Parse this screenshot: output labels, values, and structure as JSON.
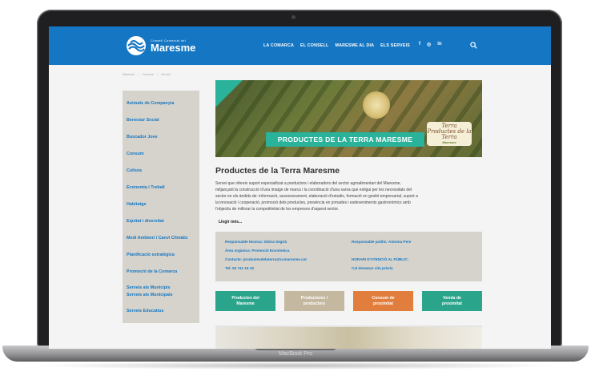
{
  "device": {
    "label": "MacBook Pro"
  },
  "header": {
    "logo_sub": "Consell Comarcal del",
    "logo_name": "Maresme",
    "nav": [
      "LA COMARCA",
      "EL CONSELL",
      "MARESME AL DIA",
      "ELS SERVEIS"
    ],
    "social": [
      "f",
      "◎",
      "in"
    ]
  },
  "breadcrumb": [
    "Maresme",
    "Comarca",
    "Serveis"
  ],
  "sidebar": {
    "items": [
      "Animals de Companyia",
      "Benestar Social",
      "Buscador Jove",
      "Consum",
      "Cultura",
      "Economia i Treball",
      "Habitatge",
      "Equitat i diversitat",
      "Medi Ambient i Canvi Climàtic",
      "Planificació estratègica",
      "Promoció de la Comarca",
      "Serveis als Municipis",
      "Serveis als Municipals",
      "Serveis Educatius"
    ]
  },
  "hero": {
    "banner_text": "PRODUCTES DE LA TERRA MARESME",
    "badge_title": "Terra Productes de la Terra",
    "badge_sub": "Maresme"
  },
  "article": {
    "title": "Productes de la Terra Maresme",
    "lines": [
      "Servei que ofereix suport especialitzat a productors i elaboradors del sector agroalimentari del Maresme,",
      "mitjançant la construcció d'una imatge de marca i la coordinació d'una xarxa que estigui per les necessitats del",
      "sector en els àmbits de: informació, assessorament, elaboració d'estudis, formació en gestió empresarial, suport a",
      "la innovació i cooperació, promoció dels productes, presència en  jornades i esdeveniments gastronòmics amb",
      "l'objectiu de millorar la competitivitat de les empreses d'aquest sector."
    ],
    "read_more": "Llegir més..."
  },
  "contact": {
    "left": [
      "Responsable tècnica: Glòria Segrià",
      "Àrea orgànica: Promoció Econòmica",
      "Contacte: productesdelaterra@ccmaresme.cat",
      "Tel: 93 741 16 33"
    ],
    "right": [
      "Responsable polític: Antonia Pere",
      "",
      "HORARI D'ATENCIÓ AL PÚBLIC:",
      "Cal demanar cita prèvia"
    ]
  },
  "buttons": [
    {
      "line1": "Productes del",
      "line2": "Maresme",
      "color": "#2aa58b"
    },
    {
      "line1": "Productores i",
      "line2": "productors",
      "color": "#c4b8a0"
    },
    {
      "line1": "Consum de",
      "line2": "proximitat",
      "color": "#e17d3d"
    },
    {
      "line1": "Venda de",
      "line2": "proximitat",
      "color": "#2aa58b"
    }
  ],
  "colors": {
    "brand_blue": "#1577c3",
    "teal": "#2ab29a",
    "orange": "#e17d3d",
    "sidebar_bg": "#d6d3cc"
  }
}
